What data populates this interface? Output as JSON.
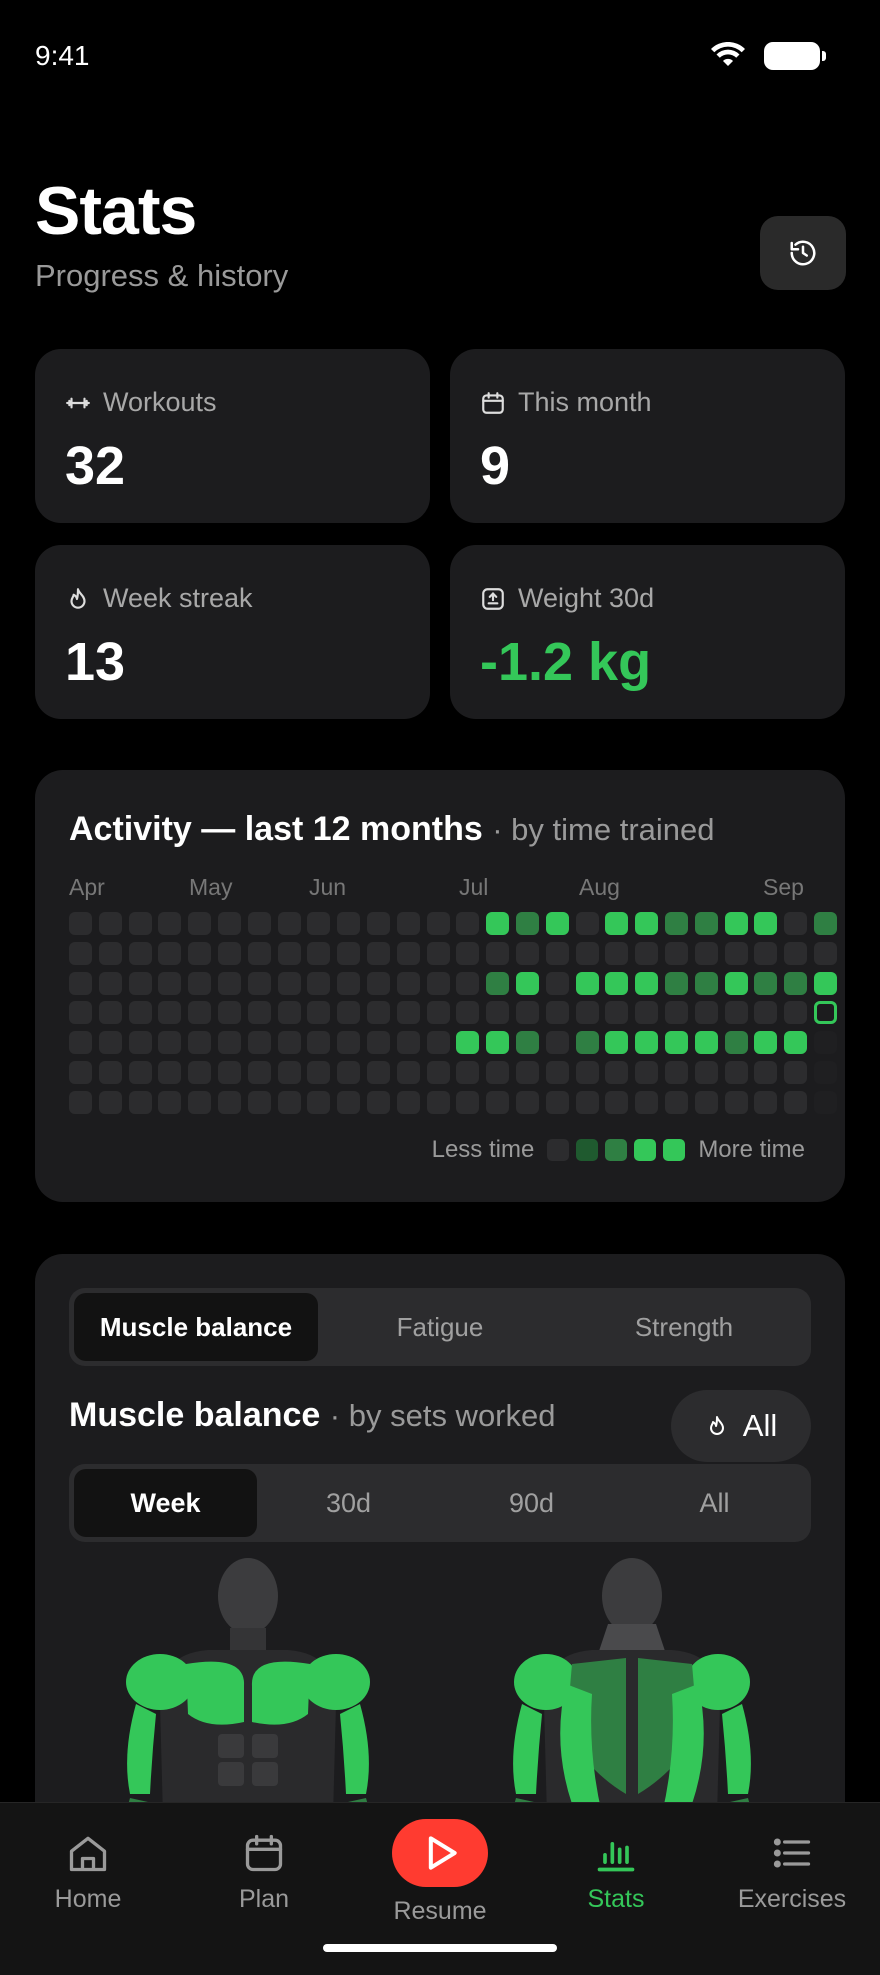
{
  "status": {
    "time": "9:41"
  },
  "header": {
    "title": "Stats",
    "subtitle": "Progress & history"
  },
  "stats": [
    {
      "label": "Workouts",
      "value": "32",
      "icon": "dumbbell-icon"
    },
    {
      "label": "This month",
      "value": "9",
      "icon": "calendar-icon"
    },
    {
      "label": "Week streak",
      "value": "13",
      "icon": "flame-icon"
    },
    {
      "label": "Weight 30d",
      "value": "-1.2 kg",
      "icon": "scale-icon",
      "color": "#34c759"
    }
  ],
  "activity": {
    "title": "Activity — last 12 months",
    "subtitle": "· by time trained",
    "months": [
      "Apr",
      "May",
      "Jun",
      "Jul",
      "Aug",
      "Sep"
    ],
    "legend_less": "Less time",
    "legend_more": "More time",
    "colors": {
      "empty": "#2c2c2e",
      "l1": "#1f5a2f",
      "l2": "#2f7f43",
      "l3": "#34c759"
    },
    "week_levels": [
      [
        0,
        0,
        0,
        0,
        0,
        0,
        0
      ],
      [
        0,
        0,
        0,
        0,
        0,
        0,
        0
      ],
      [
        0,
        0,
        0,
        0,
        0,
        0,
        0
      ],
      [
        0,
        0,
        0,
        0,
        0,
        0,
        0
      ],
      [
        0,
        0,
        0,
        0,
        0,
        0,
        0
      ],
      [
        0,
        0,
        0,
        0,
        0,
        0,
        0
      ],
      [
        0,
        0,
        0,
        0,
        0,
        0,
        0
      ],
      [
        0,
        0,
        0,
        0,
        0,
        0,
        0
      ],
      [
        0,
        0,
        0,
        0,
        0,
        0,
        0
      ],
      [
        0,
        0,
        0,
        0,
        0,
        0,
        0
      ],
      [
        0,
        0,
        0,
        0,
        0,
        0,
        0
      ],
      [
        0,
        0,
        0,
        0,
        0,
        0,
        0
      ],
      [
        0,
        0,
        0,
        0,
        0,
        0,
        0
      ],
      [
        0,
        0,
        0,
        0,
        3,
        0,
        0
      ],
      [
        3,
        0,
        2,
        0,
        3,
        0,
        0
      ],
      [
        2,
        0,
        3,
        0,
        2,
        0,
        0
      ],
      [
        3,
        0,
        0,
        0,
        0,
        0,
        0
      ],
      [
        0,
        0,
        3,
        0,
        2,
        0,
        0
      ],
      [
        3,
        0,
        3,
        0,
        3,
        0,
        0
      ],
      [
        3,
        0,
        3,
        0,
        3,
        0,
        0
      ],
      [
        2,
        0,
        2,
        0,
        3,
        0,
        0
      ],
      [
        2,
        0,
        2,
        0,
        3,
        0,
        0
      ],
      [
        3,
        0,
        3,
        0,
        2,
        0,
        0
      ],
      [
        3,
        0,
        2,
        0,
        3,
        0,
        0
      ],
      [
        0,
        0,
        2,
        0,
        3,
        0,
        0
      ],
      [
        2,
        0,
        3,
        "today",
        -1,
        -1,
        -1
      ]
    ]
  },
  "muscle": {
    "tabs": [
      "Muscle balance",
      "Fatigue",
      "Strength"
    ],
    "active_tab": 0,
    "title": "Muscle balance",
    "subtitle": "· by sets worked",
    "filter": "All",
    "ranges": [
      "Week",
      "30d",
      "90d",
      "All"
    ],
    "active_range": 0
  },
  "nav": {
    "items": [
      {
        "label": "Home",
        "icon": "home-icon"
      },
      {
        "label": "Plan",
        "icon": "calendar-icon"
      },
      {
        "label": "Resume",
        "icon": "play-icon"
      },
      {
        "label": "Stats",
        "icon": "bar-chart-icon"
      },
      {
        "label": "Exercises",
        "icon": "list-icon"
      }
    ],
    "active": 3
  }
}
